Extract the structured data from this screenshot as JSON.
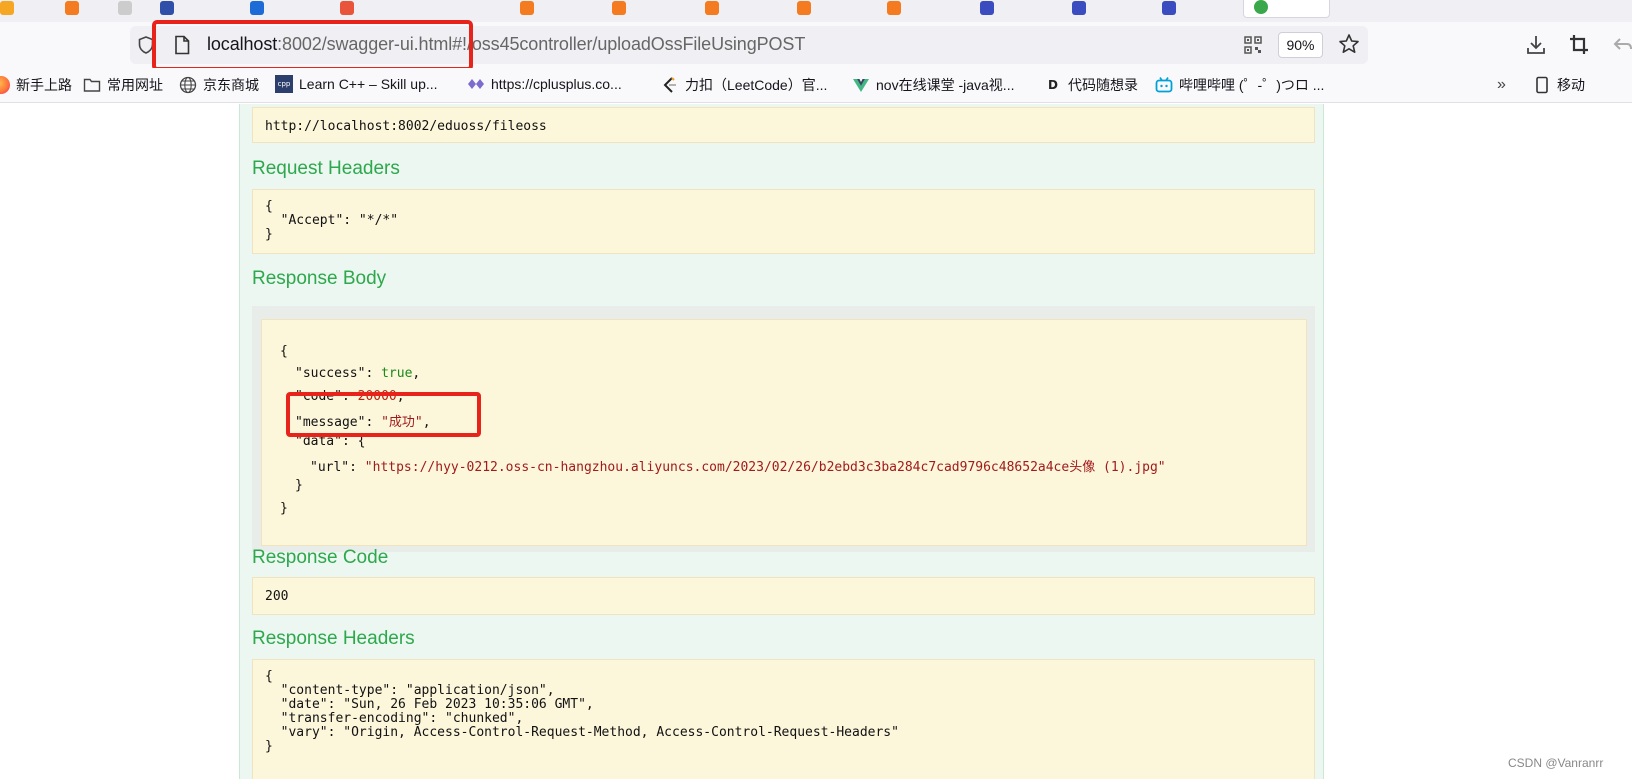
{
  "browser": {
    "url_host": "localhost",
    "url_rest": ":8002/swagger-ui.html#!/oss45controller/uploadOssFileUsingPOST",
    "zoom": "90%"
  },
  "bookmarks": [
    {
      "label": "新手上路",
      "icon": "firefox-icon"
    },
    {
      "label": "常用网址",
      "icon": "folder-icon"
    },
    {
      "label": "京东商城",
      "icon": "globe-icon"
    },
    {
      "label": "Learn C++ – Skill up...",
      "icon": "cpp-icon"
    },
    {
      "label": "https://cplusplus.co...",
      "icon": "cplusplus-icon"
    },
    {
      "label": "力扣（LeetCode）官...",
      "icon": "leetcode-icon"
    },
    {
      "label": "nov在线课堂 -java视...",
      "icon": "vue-icon"
    },
    {
      "label": "代码随想录",
      "icon": "dm-icon"
    },
    {
      "label": "哔哩哔哩 (゜-゜)つロ ...",
      "icon": "bilibili-icon"
    },
    {
      "label": "移动",
      "icon": "mobile-icon"
    }
  ],
  "swagger": {
    "request_url": "http://localhost:8002/eduoss/fileoss",
    "request_headers_title": "Request Headers",
    "request_headers_body": "{\n  \"Accept\": \"*/*\"\n}",
    "response_body_title": "Response Body",
    "response_body": {
      "open": "{",
      "success_key": "\"success\"",
      "success_val": "true",
      "code_key": "\"code\"",
      "code_val": "20000",
      "message_key": "\"message\"",
      "message_val": "\"成功\"",
      "data_key": "\"data\"",
      "url_key": "\"url\"",
      "url_val": "\"https://hyy-0212.oss-cn-hangzhou.aliyuncs.com/2023/02/26/b2ebd3c3ba284c7cad9796c48652a4ce头像 (1).jpg\"",
      "inner_close": "}",
      "close": "}"
    },
    "response_code_title": "Response Code",
    "response_code": "200",
    "response_headers_title": "Response Headers",
    "response_headers_body": "{\n  \"content-type\": \"application/json\",\n  \"date\": \"Sun, 26 Feb 2023 10:35:06 GMT\",\n  \"transfer-encoding\": \"chunked\",\n  \"vary\": \"Origin, Access-Control-Request-Method, Access-Control-Request-Headers\"\n}"
  },
  "watermark": "CSDN @Vanranrr"
}
